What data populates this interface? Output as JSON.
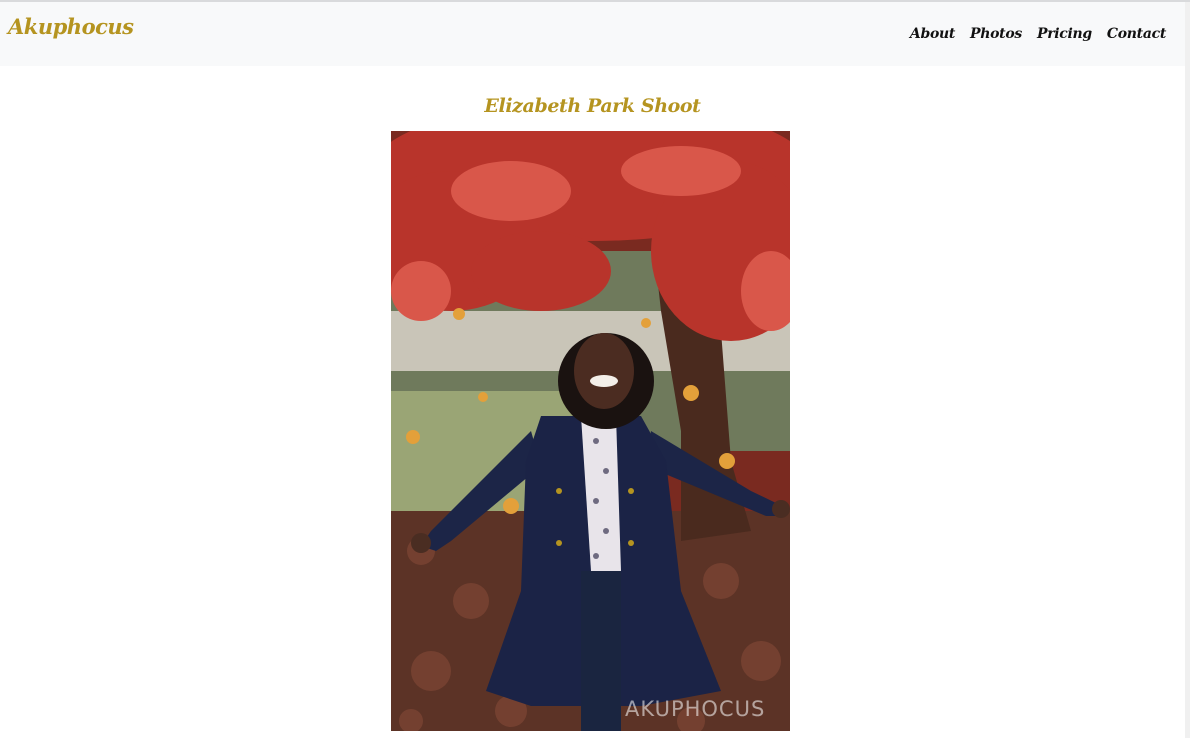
{
  "brand": {
    "name": "Akuphocus"
  },
  "nav": {
    "items": [
      "About",
      "Photos",
      "Pricing",
      "Contact"
    ]
  },
  "main": {
    "title": "Elizabeth Park Shoot",
    "photo": {
      "watermark": "AKUPHOCUS"
    }
  },
  "colors": {
    "accent": "#b59420",
    "navbar_bg": "#f8f9fa"
  }
}
